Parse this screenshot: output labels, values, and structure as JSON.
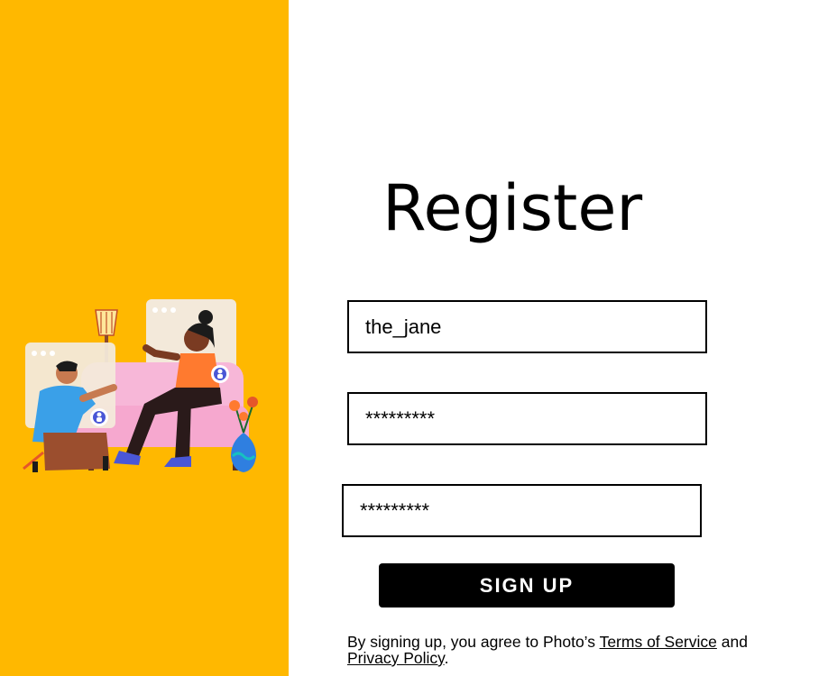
{
  "colors": {
    "left_panel_bg": "#FFB800",
    "button_bg": "#000000",
    "button_text": "#FFFFFF"
  },
  "page": {
    "title": "Register"
  },
  "form": {
    "username_value": "the_jane",
    "password_value": "*********",
    "confirm_password_value": "*********",
    "submit_label": "SIGN UP"
  },
  "terms": {
    "prefix": "By signing up, you agree to Photo’s ",
    "terms_link": "Terms of Service",
    "middle": " and",
    "privacy_link": "Privacy Policy",
    "suffix": "."
  },
  "illustration": {
    "icons": [
      "floor-lamp-icon",
      "sofa-icon",
      "video-call-window-icon",
      "person-sitting-icon",
      "user-avatar-icon",
      "flower-vase-icon"
    ]
  }
}
